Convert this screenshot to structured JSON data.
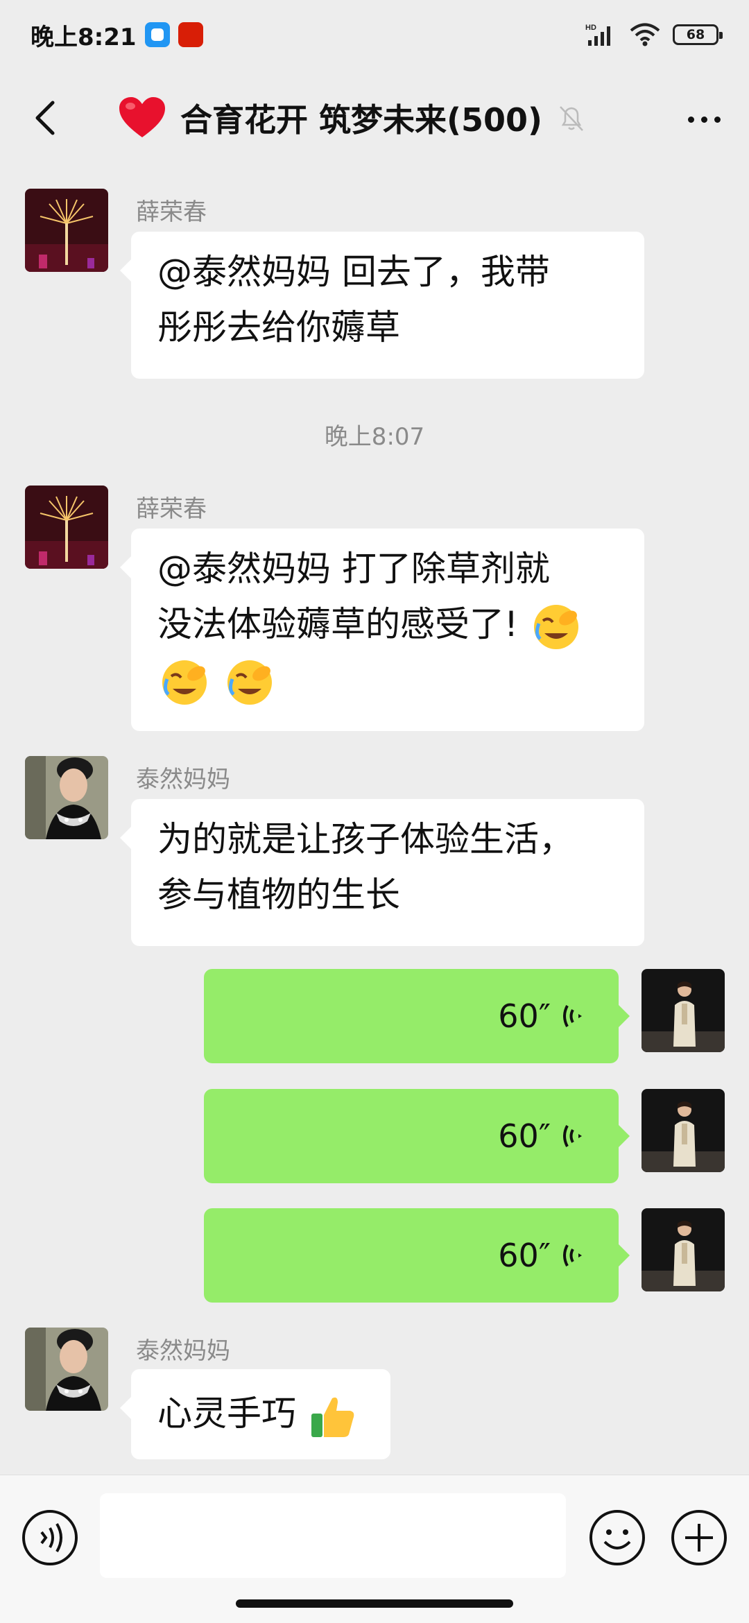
{
  "status_bar": {
    "time": "晚上8:21",
    "network": "HD",
    "battery": "68"
  },
  "header": {
    "title": "合育花开 筑梦未来(500)"
  },
  "messages": [
    {
      "sender": "薛荣春",
      "line1": "@泰然妈妈  回去了，我带",
      "line2": "彤彤去给你薅草"
    },
    {
      "timestamp": "晚上8:07"
    },
    {
      "sender": "薛荣春",
      "line1": "@泰然妈妈  打了除草剂就",
      "line2": "没法体验薅草的感受了!"
    },
    {
      "sender": "泰然妈妈",
      "line1": "为的就是让孩子体验生活，",
      "line2": "参与植物的生长"
    },
    {
      "voice_duration": "60″"
    },
    {
      "voice_duration": "60″"
    },
    {
      "voice_duration": "60″"
    },
    {
      "sender": "泰然妈妈",
      "line1": "心灵手巧"
    }
  ],
  "colors": {
    "background": "#ededed",
    "sent_bubble": "#95ec69",
    "received_bubble": "#ffffff",
    "heart": "#e8112d"
  }
}
